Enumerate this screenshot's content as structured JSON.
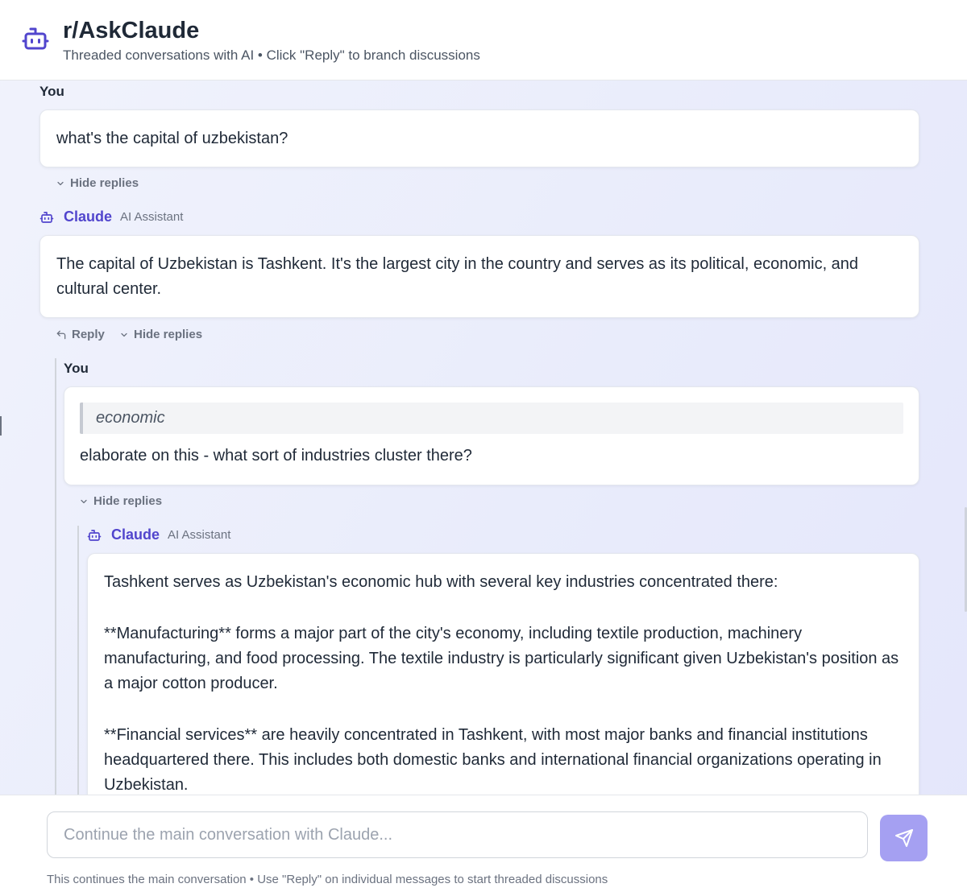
{
  "header": {
    "icon": "robot-icon",
    "title": "r/AskClaude",
    "subtitle": "Threaded conversations with AI • Click \"Reply\" to branch discussions"
  },
  "colors": {
    "accent": "#5145cd",
    "send_button": "#a5a0f2",
    "background": "#eef0fb"
  },
  "thread": {
    "msg1": {
      "author": "You",
      "text": "what's the capital of uzbekistan?",
      "hide_replies": "Hide replies"
    },
    "msg2": {
      "author": "Claude",
      "role": "AI Assistant",
      "text": "The capital of Uzbekistan is Tashkent. It's the largest city in the country and serves as its political, economic, and cultural center.",
      "reply": "Reply",
      "hide_replies": "Hide replies"
    },
    "msg3": {
      "author": "You",
      "quote": "economic",
      "text": "elaborate on this - what sort of industries cluster there?",
      "hide_replies": "Hide replies"
    },
    "msg4": {
      "author": "Claude",
      "role": "AI Assistant",
      "paragraphs": [
        "Tashkent serves as Uzbekistan's economic hub with several key industries concentrated there:",
        "**Manufacturing** forms a major part of the city's economy, including textile production, machinery manufacturing, and food processing. The textile industry is particularly significant given Uzbekistan's position as a major cotton producer.",
        "**Financial services** are heavily concentrated in Tashkent, with most major banks and financial institutions headquartered there. This includes both domestic banks and international financial organizations operating in Uzbekistan."
      ]
    }
  },
  "composer": {
    "placeholder": "Continue the main conversation with Claude...",
    "send_icon": "send-icon",
    "hint": "This continues the main conversation • Use \"Reply\" on individual messages to start threaded discussions"
  }
}
